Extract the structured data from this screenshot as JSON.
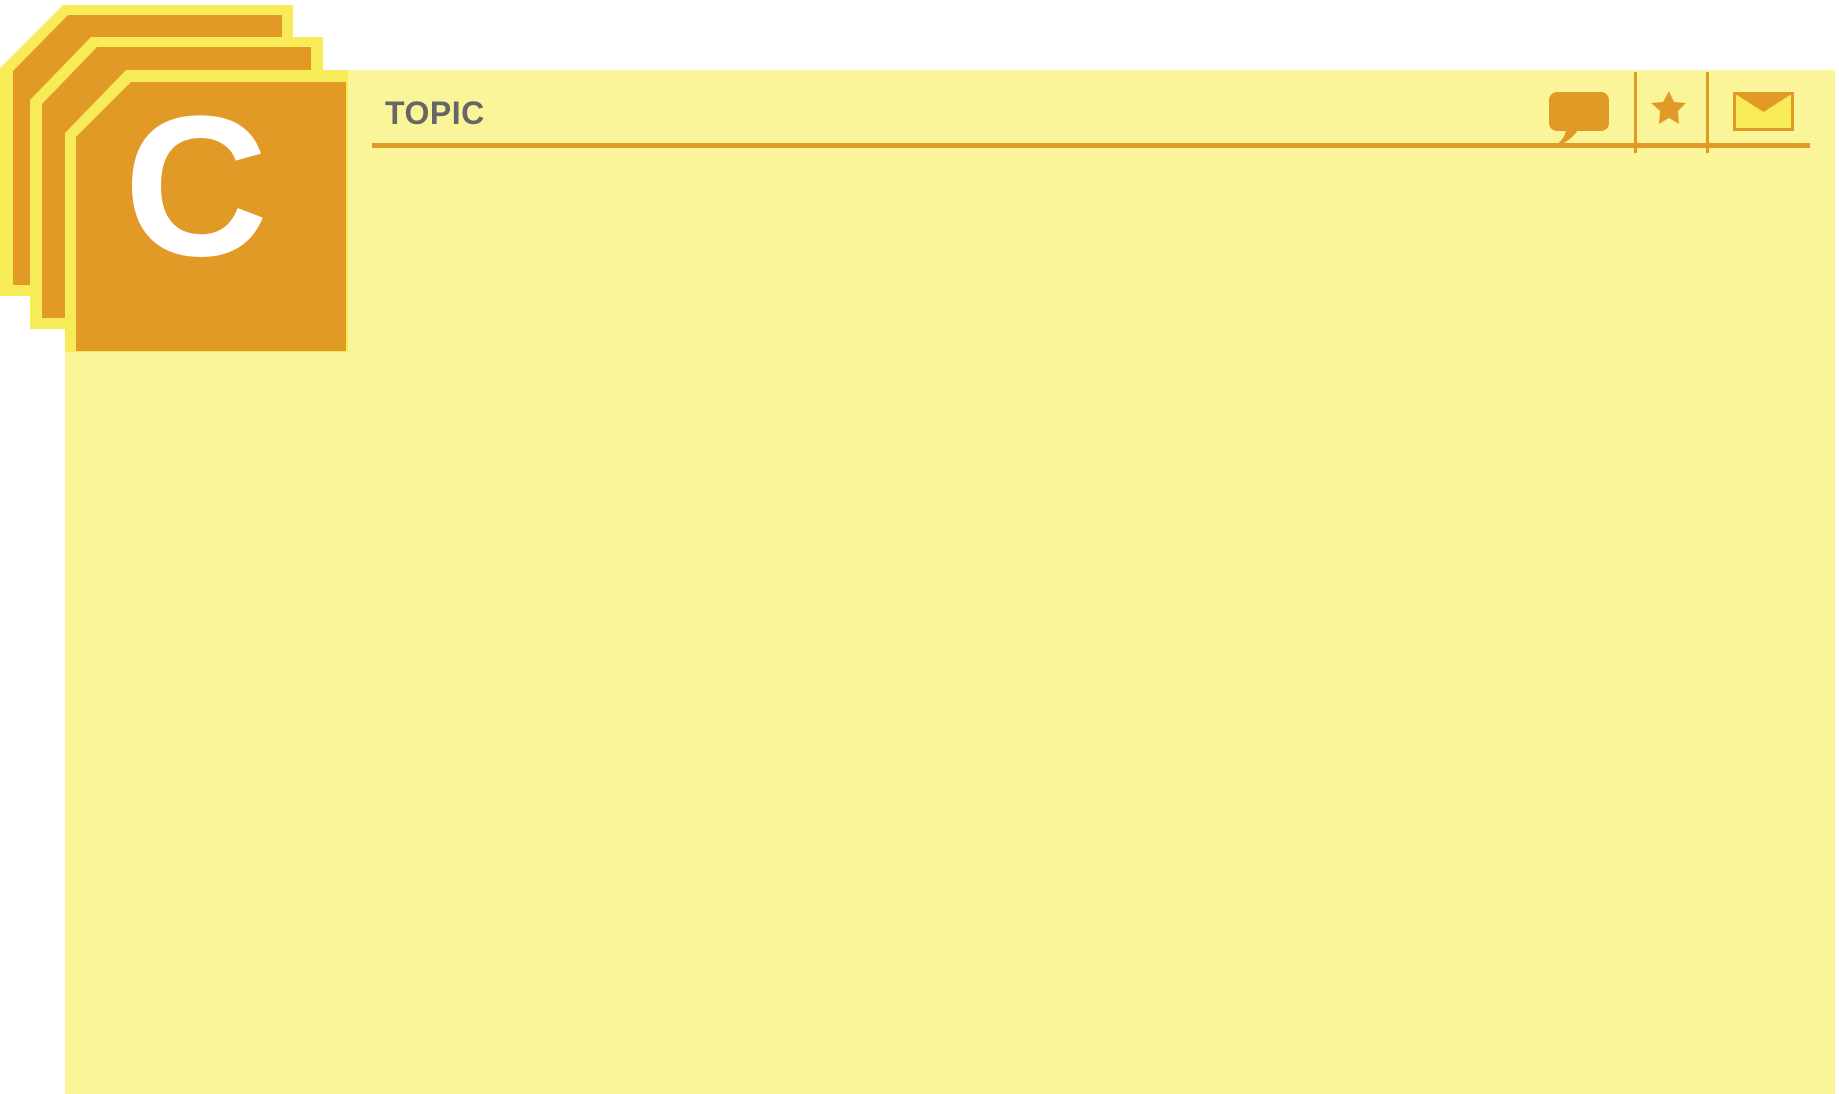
{
  "colors": {
    "panel_background": "#faf598",
    "accent": "#e29a26",
    "card_border": "#f7ec58",
    "topic_text": "#666666",
    "card_letter": "#ffffff"
  },
  "card": {
    "letter": "C"
  },
  "header": {
    "topic_label": "TOPIC"
  },
  "toolbar": {
    "icons": [
      "speech-bubble-icon",
      "star-icon",
      "envelope-icon"
    ]
  }
}
